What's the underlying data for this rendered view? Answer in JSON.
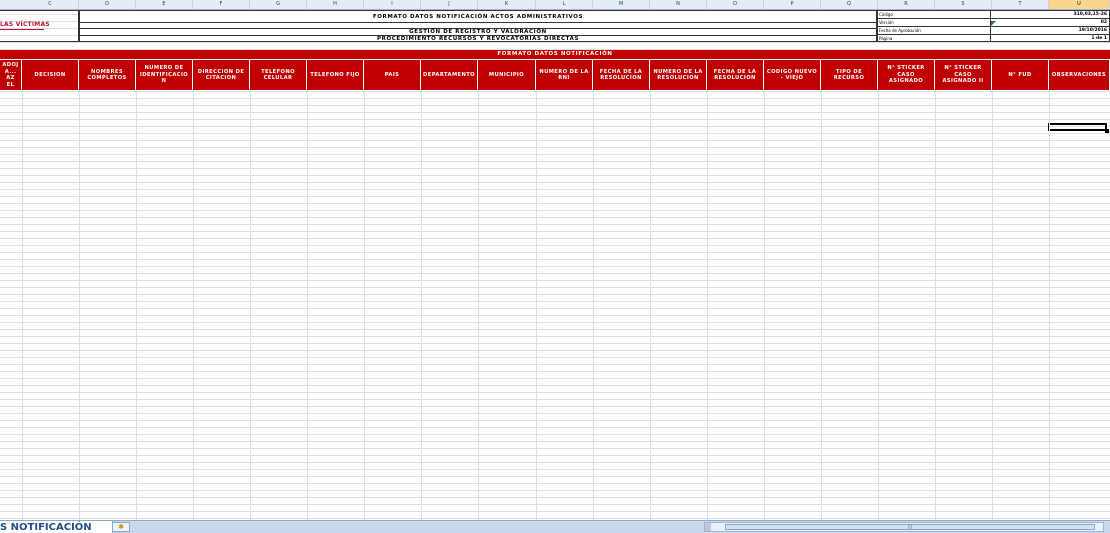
{
  "columns": [
    "C",
    "D",
    "E",
    "F",
    "G",
    "H",
    "I",
    "J",
    "K",
    "L",
    "M",
    "N",
    "O",
    "P",
    "Q",
    "R",
    "S",
    "T",
    "U"
  ],
  "logo": {
    "text": "LAS VÍCTIMAS"
  },
  "title": {
    "line1": "FORMATO DATOS NOTIFICACIÓN ACTOS ADMINISTRATIVOS",
    "line2": "GESTIÓN DE REGISTRO Y VALORACIÓN",
    "line3": "PROCEDIMIENTO RECURSOS Y REVOCATORIAS DIRECTAS"
  },
  "meta": [
    {
      "label": "Código",
      "value": "310,03,15-26"
    },
    {
      "label": "Versión",
      "value": "02"
    },
    {
      "label": "Fecha de Aprobación",
      "value": "19/10/2016"
    },
    {
      "label": "Página",
      "value": "1 de 1"
    }
  ],
  "banner": "FORMATO DATOS NOTIFICACIÓN",
  "headers": [
    "ADOJA... AZ EL",
    "DECISION",
    "NOMBRES COMPLETOS",
    "NUMERO DE IDENTIFICACION",
    "DIRECCION DE CITACION",
    "TELEFONO CELULAR",
    "TELEFONO FIJO",
    "PAIS",
    "DEPARTAMENTO",
    "MUNICIPIO",
    "NUMERO DE LA RNI",
    "FECHA DE LA RESOLUCION",
    "NUMERO DE LA RESOLUCION",
    "FECHA DE LA RESOLUCION",
    "CODIGO NUEVO - VIEJO",
    "TIPO DE RECURSO",
    "N° STICKER CASO ASIGNADO",
    "N° STICKER CASO ASIGNADO II",
    "N° FUD",
    "OBSERVACIONES"
  ],
  "sheet_tab": "S NOTIFICACIÓN",
  "colors": {
    "header_red": "#c00000",
    "logo_red": "#c0102f",
    "tab_text": "#1f4e8c"
  }
}
